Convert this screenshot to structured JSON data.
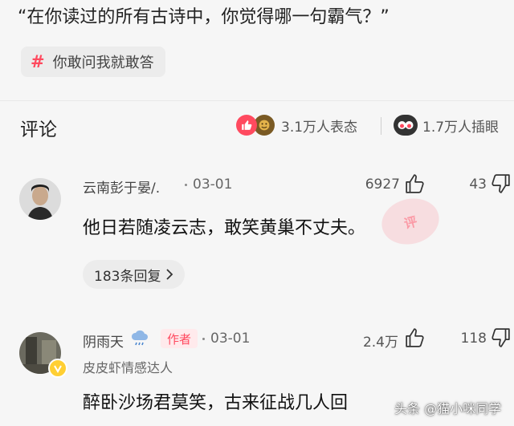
{
  "post": {
    "question": "“在你读过的所有古诗中，你觉得哪一句霸气？”",
    "topic": "你敢问我就敢答"
  },
  "comments_header": {
    "title": "评论",
    "reactions_count": "3.1万人表态",
    "collect_count": "1.7万人插眼"
  },
  "comments": [
    {
      "username": "云南彭于晏/.",
      "date": "03-01",
      "likes": "6927",
      "dislikes": "43",
      "text": "他日若随凌云志，敢笑黄巢不丈夫。",
      "replies": "183条回复",
      "stamp": "评"
    },
    {
      "username": "阴雨天",
      "author_badge": "作者",
      "date": "03-01",
      "likes": "2.4万",
      "dislikes": "118",
      "sub_label": "皮皮虾情感达人",
      "text": "醉卧沙场君莫笑，古来征战几人回"
    }
  ],
  "watermark": "头条 @猫小咪同学",
  "colors": {
    "accent": "#ff4a5f",
    "badge_bg": "#ffeaec",
    "verify": "#ffcf33"
  },
  "icons": [
    "hash-icon",
    "like-reaction-icon",
    "face-reaction-icon",
    "eye-collect-icon",
    "thumb-up-icon",
    "thumb-down-icon",
    "chevron-right-icon",
    "rain-cloud-icon",
    "verified-badge-icon"
  ]
}
